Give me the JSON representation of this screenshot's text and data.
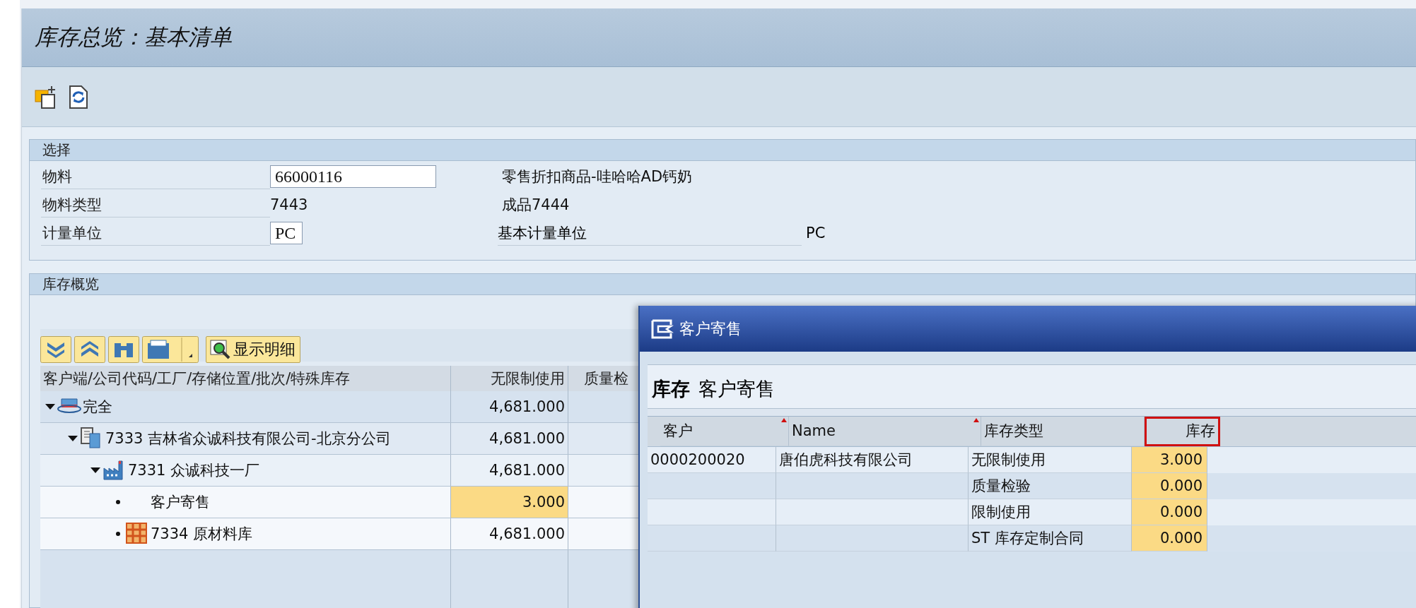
{
  "window": {
    "title": "库存总览：基本清单"
  },
  "selection": {
    "title": "选择",
    "fields": [
      {
        "label": "物料",
        "kind": "input",
        "value": "66000116",
        "description": "零售折扣商品-哇哈哈AD钙奶"
      },
      {
        "label": "物料类型",
        "kind": "text",
        "value": "7443",
        "description": "成品7444"
      },
      {
        "label": "计量单位",
        "kind": "input",
        "value": "PC",
        "sub_label": "基本计量单位",
        "sub_value": "PC"
      }
    ]
  },
  "overview": {
    "title": "库存概览",
    "detail_button": "显示明细",
    "columns": [
      "客户端/公司代码/工厂/存储位置/批次/特殊库存",
      "无限制使用",
      "质量检"
    ],
    "tree": [
      {
        "kind": "client",
        "label": "完全",
        "unrestricted": "4,681.000",
        "highlighted": false,
        "expanded": true,
        "children": [
          {
            "kind": "company",
            "label": "7333 吉林省众诚科技有限公司-北京分公司",
            "unrestricted": "4,681.000",
            "highlighted": false,
            "expanded": true,
            "children": [
              {
                "kind": "plant",
                "label": "7331 众诚科技一厂",
                "unrestricted": "4,681.000",
                "highlighted": false,
                "expanded": true,
                "children": [
                  {
                    "kind": "special",
                    "label": "客户寄售",
                    "unrestricted": "3.000",
                    "highlighted": true
                  },
                  {
                    "kind": "storage",
                    "label": "7334 原材料库",
                    "unrestricted": "4,681.000",
                    "highlighted": false
                  }
                ]
              }
            ]
          }
        ]
      }
    ]
  },
  "popup": {
    "title": "客户寄售",
    "header_label": "库存",
    "header_value": "客户寄售",
    "columns": [
      {
        "label": "客户",
        "sorted": true,
        "selected": false
      },
      {
        "label": "Name",
        "sorted": true,
        "selected": false
      },
      {
        "label": "库存类型",
        "sorted": false,
        "selected": false
      },
      {
        "label": "库存",
        "sorted": false,
        "selected": true
      }
    ],
    "rows": [
      {
        "customer": "0000200020",
        "name": "唐伯虎科技有限公司",
        "stock_type": "无限制使用",
        "stock": "3.000"
      },
      {
        "stock_type": "质量检验",
        "stock": "0.000"
      },
      {
        "stock_type": "限制使用",
        "stock": "0.000"
      },
      {
        "stock_type": "ST 库存定制合同",
        "stock": "0.000"
      }
    ]
  }
}
